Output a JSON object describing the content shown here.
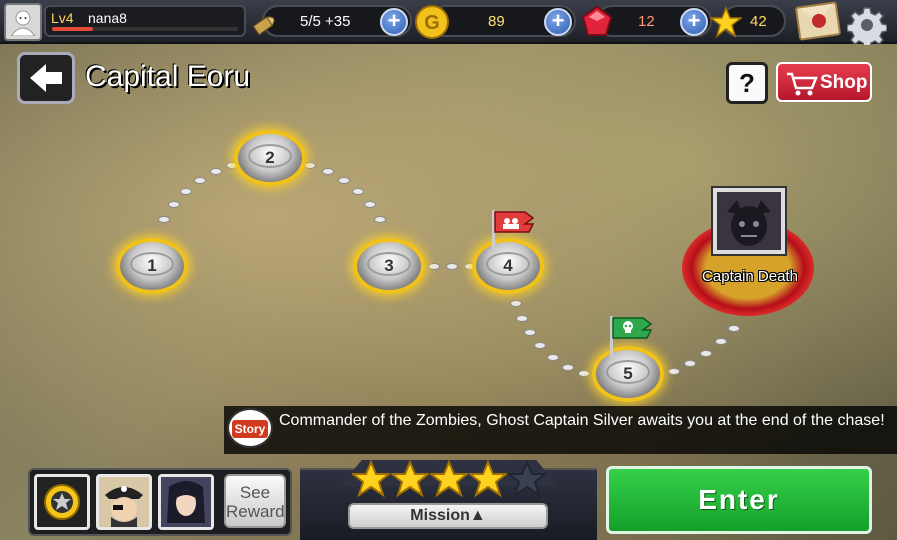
{
  "player": {
    "level": "Lv4",
    "name": "nana8",
    "xp_fraction": 0.22
  },
  "resources": {
    "bullets": "5/5 +35",
    "gold": "89",
    "gems": "12",
    "stars": "42"
  },
  "header": {
    "title": "Capital Eoru",
    "help": "?",
    "shop": "Shop"
  },
  "stages": [
    {
      "num": "1"
    },
    {
      "num": "2"
    },
    {
      "num": "3"
    },
    {
      "num": "4"
    },
    {
      "num": "5"
    }
  ],
  "boss": {
    "name": "Captain Death"
  },
  "story": {
    "badge": "Story",
    "text": "Commander of the Zombies, Ghost Captain Silver awaits you at the end of the chase!"
  },
  "bottom": {
    "see_reward": "See Reward",
    "mission": "Mission▲",
    "enter": "Enter",
    "stars_earned": 4,
    "stars_total": 5
  },
  "colors": {
    "enter": "#22b83a",
    "shop": "#d42a3e",
    "gold_ring": "#f1c21a"
  }
}
